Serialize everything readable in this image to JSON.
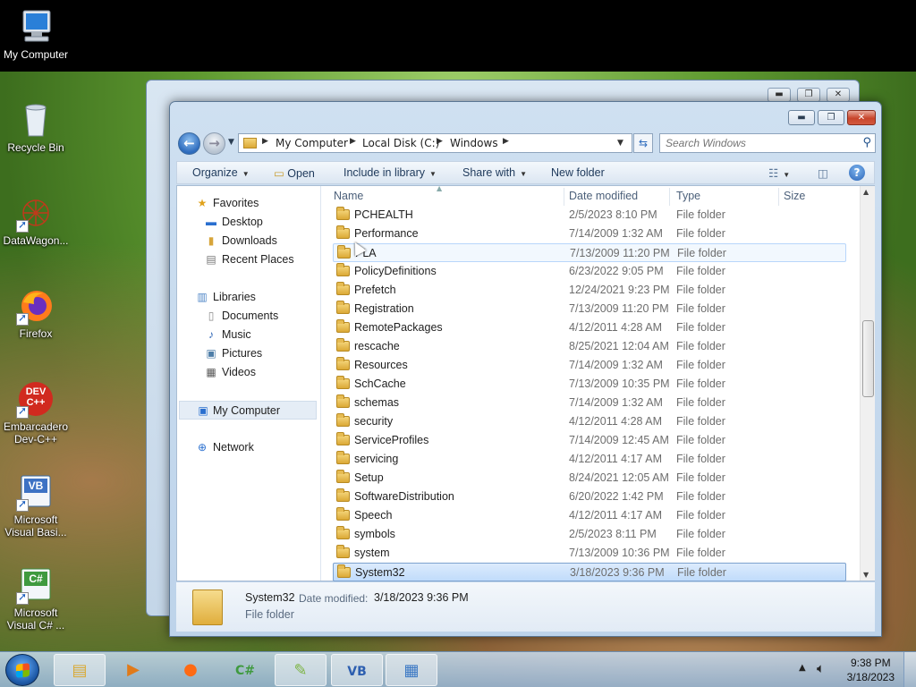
{
  "desktop": {
    "icons": [
      {
        "label": "My Computer",
        "icon": "computer-icon"
      },
      {
        "label": "Recycle Bin",
        "icon": "recycle-bin-icon"
      },
      {
        "label": "DataWagon...",
        "icon": "datawagon-icon"
      },
      {
        "label": "Firefox",
        "icon": "firefox-icon"
      },
      {
        "label": "Embarcadero Dev-C++",
        "icon": "devcpp-icon",
        "badge": "DEV\nC++"
      },
      {
        "label": "Microsoft Visual Basi...",
        "icon": "visual-basic-icon",
        "badge": "VB"
      },
      {
        "label": "Microsoft Visual C# ...",
        "icon": "visual-csharp-icon",
        "badge": "C#"
      }
    ]
  },
  "window": {
    "controls": {
      "minimize": "▬",
      "maximize": "❐",
      "close": "✕"
    },
    "breadcrumb": [
      "My Computer",
      "Local Disk (C:)",
      "Windows"
    ],
    "search_placeholder": "Search Windows",
    "toolbar": {
      "organize": "Organize",
      "open": "Open",
      "include": "Include in library",
      "share": "Share with",
      "new_folder": "New folder"
    },
    "nav": {
      "favorites": "Favorites",
      "desktop": "Desktop",
      "downloads": "Downloads",
      "recent": "Recent Places",
      "libraries": "Libraries",
      "documents": "Documents",
      "music": "Music",
      "pictures": "Pictures",
      "videos": "Videos",
      "computer": "My Computer",
      "network": "Network"
    },
    "columns": {
      "name": "Name",
      "date": "Date modified",
      "type": "Type",
      "size": "Size"
    },
    "files": [
      {
        "name": "PCHEALTH",
        "date": "2/5/2023 8:10 PM",
        "type": "File folder"
      },
      {
        "name": "Performance",
        "date": "7/14/2009 1:32 AM",
        "type": "File folder"
      },
      {
        "name": "PLA",
        "date": "7/13/2009 11:20 PM",
        "type": "File folder"
      },
      {
        "name": "PolicyDefinitions",
        "date": "6/23/2022 9:05 PM",
        "type": "File folder"
      },
      {
        "name": "Prefetch",
        "date": "12/24/2021 9:23 PM",
        "type": "File folder"
      },
      {
        "name": "Registration",
        "date": "7/13/2009 11:20 PM",
        "type": "File folder"
      },
      {
        "name": "RemotePackages",
        "date": "4/12/2011 4:28 AM",
        "type": "File folder"
      },
      {
        "name": "rescache",
        "date": "8/25/2021 12:04 AM",
        "type": "File folder"
      },
      {
        "name": "Resources",
        "date": "7/14/2009 1:32 AM",
        "type": "File folder"
      },
      {
        "name": "SchCache",
        "date": "7/13/2009 10:35 PM",
        "type": "File folder"
      },
      {
        "name": "schemas",
        "date": "7/14/2009 1:32 AM",
        "type": "File folder"
      },
      {
        "name": "security",
        "date": "4/12/2011 4:28 AM",
        "type": "File folder"
      },
      {
        "name": "ServiceProfiles",
        "date": "7/14/2009 12:45 AM",
        "type": "File folder"
      },
      {
        "name": "servicing",
        "date": "4/12/2011 4:17 AM",
        "type": "File folder"
      },
      {
        "name": "Setup",
        "date": "8/24/2021 12:05 AM",
        "type": "File folder"
      },
      {
        "name": "SoftwareDistribution",
        "date": "6/20/2022 1:42 PM",
        "type": "File folder"
      },
      {
        "name": "Speech",
        "date": "4/12/2011 4:17 AM",
        "type": "File folder"
      },
      {
        "name": "symbols",
        "date": "2/5/2023 8:11 PM",
        "type": "File folder"
      },
      {
        "name": "system",
        "date": "7/13/2009 10:36 PM",
        "type": "File folder"
      },
      {
        "name": "System32",
        "date": "3/18/2023 9:36 PM",
        "type": "File folder"
      }
    ],
    "hovered_row": 2,
    "selected_row": 19,
    "details": {
      "name": "System32",
      "date_label": "Date modified:",
      "date_value": "3/18/2023 9:36 PM",
      "type": "File folder"
    }
  },
  "taskbar": {
    "apps": [
      "explorer-icon",
      "media-player-icon",
      "firefox-icon",
      "visual-csharp-icon",
      "notepadpp-icon",
      "visual-basic-icon",
      "control-panel-icon"
    ],
    "clock_time": "9:38 PM",
    "clock_date": "3/18/2023"
  }
}
